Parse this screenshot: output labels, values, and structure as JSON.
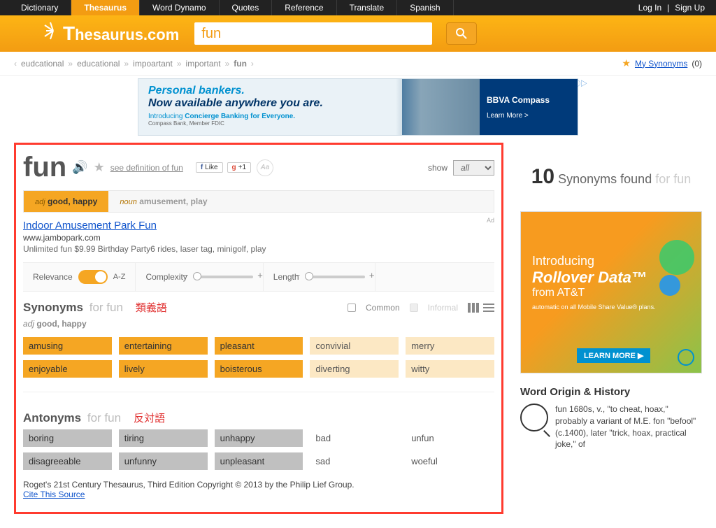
{
  "nav": {
    "items": [
      "Dictionary",
      "Thesaurus",
      "Word Dynamo",
      "Quotes",
      "Reference",
      "Translate",
      "Spanish"
    ],
    "active_index": 1,
    "login": "Log In",
    "signup": "Sign Up"
  },
  "logo": "hesaurus.com",
  "search": {
    "value": "fun"
  },
  "breadcrumb": [
    "eudcational",
    "educational",
    "impoartant",
    "important",
    "fun"
  ],
  "my_synonyms": {
    "label": "My Synonyms",
    "count": "(0)"
  },
  "banner_ad": {
    "line1": "Personal bankers.",
    "line2": "Now available anywhere you are.",
    "sub_prefix": "Introducing ",
    "sub_bold": "Concierge Banking for Everyone.",
    "disclaimer": "Compass Bank, Member FDIC",
    "brand": "BBVA Compass",
    "cta": "Learn More >"
  },
  "word": "fun",
  "def_link": "see definition of fun",
  "social": {
    "like": "Like",
    "plus": "+1"
  },
  "show": {
    "label": "show",
    "value": "all"
  },
  "senses": [
    {
      "pos": "adj",
      "desc": "good, happy"
    },
    {
      "pos": "noun",
      "desc": "amusement, play"
    }
  ],
  "inline_ad": {
    "title": "Indoor Amusement Park Fun",
    "domain": "www.jambopark.com",
    "text": "Unlimited fun $9.99 Birthday Party6 rides, laser tag, minigolf, play",
    "label": "Ad"
  },
  "filters": {
    "relevance": "Relevance",
    "az": "A-Z",
    "complexity": "Complexity",
    "length": "Length"
  },
  "synonyms_section": {
    "title": "Synonyms",
    "for": "for fun",
    "jp": "類義語",
    "common": "Common",
    "informal": "Informal",
    "subsense_pos": "adj",
    "subsense_desc": "good, happy"
  },
  "synonyms_strong": [
    "amusing",
    "entertaining",
    "pleasant"
  ],
  "synonyms_weak_row1": [
    "convivial",
    "merry"
  ],
  "synonyms_strong_row2": [
    "enjoyable",
    "lively",
    "boisterous"
  ],
  "synonyms_weak_row2": [
    "diverting",
    "witty"
  ],
  "antonyms_section": {
    "title": "Antonyms",
    "for": "for fun",
    "jp": "反対語"
  },
  "antonyms_strong_r1": [
    "boring",
    "tiring",
    "unhappy"
  ],
  "antonyms_weak_r1": [
    "bad",
    "unfun"
  ],
  "antonyms_strong_r2": [
    "disagreeable",
    "unfunny",
    "unpleasant"
  ],
  "antonyms_weak_r2": [
    "sad",
    "woeful"
  ],
  "attribution": {
    "text": "Roget's 21st Century Thesaurus, Third Edition Copyright © 2013 by the Philip Lief Group.",
    "cite": "Cite This Source"
  },
  "syn_found": {
    "count": "10",
    "label": "Synonyms found",
    "for": "for fun"
  },
  "side_ad": {
    "intro": "Introducing",
    "brand": "Rollover Data",
    "from": "from AT&T",
    "small": "automatic on all Mobile Share Value® plans.",
    "cta": "LEARN MORE ▶"
  },
  "origin": {
    "title": "Word Origin & History",
    "text": "fun 1680s, v., \"to cheat, hoax,\" probably a variant of M.E. fon \"befool\" (c.1400), later \"trick, hoax, practical joke,\" of"
  }
}
